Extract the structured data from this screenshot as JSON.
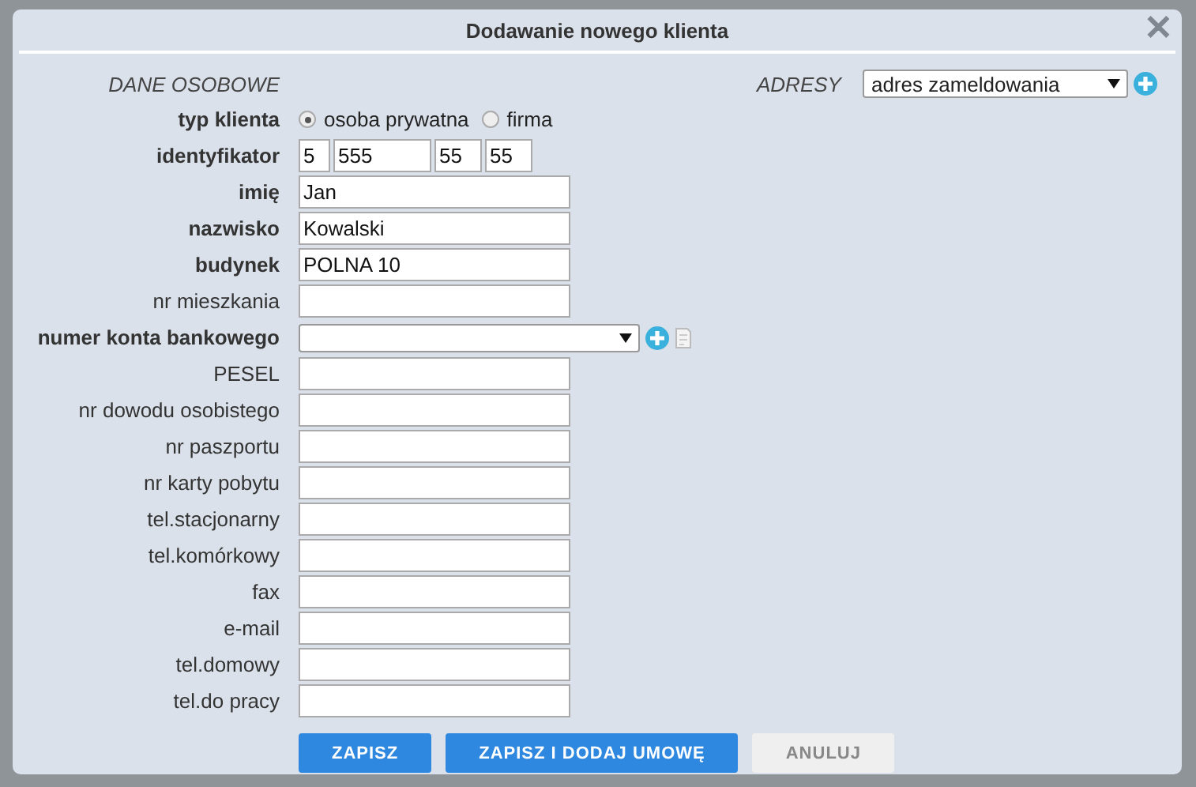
{
  "dialog": {
    "title": "Dodawanie nowego klienta",
    "close": "✕"
  },
  "section_personal": "DANE OSOBOWE",
  "section_address": {
    "label": "ADRESY",
    "value": "adres zameldowania"
  },
  "client_type": {
    "label": "typ klienta",
    "options": [
      {
        "label": "osoba prywatna",
        "selected": true
      },
      {
        "label": "firma",
        "selected": false
      }
    ]
  },
  "identifier": {
    "label": "identyfikator",
    "parts": [
      "5",
      "555",
      "55",
      "55"
    ]
  },
  "fields": [
    {
      "kind": "text",
      "label": "imię",
      "bold": true,
      "value": "Jan"
    },
    {
      "kind": "text",
      "label": "nazwisko",
      "bold": true,
      "value": "Kowalski"
    },
    {
      "kind": "text",
      "label": "budynek",
      "bold": true,
      "value": "POLNA 10"
    },
    {
      "kind": "text",
      "label": "nr mieszkania",
      "bold": false
    },
    {
      "kind": "select",
      "label": "numer konta bankowego",
      "bold": true
    },
    {
      "kind": "text",
      "label": "PESEL",
      "bold": false
    },
    {
      "kind": "text",
      "label": "nr dowodu osobistego",
      "bold": false
    },
    {
      "kind": "text",
      "label": "nr paszportu",
      "bold": false
    },
    {
      "kind": "text",
      "label": "nr karty pobytu",
      "bold": false
    },
    {
      "kind": "text",
      "label": "tel.stacjonarny",
      "bold": false
    },
    {
      "kind": "text",
      "label": "tel.komórkowy",
      "bold": false
    },
    {
      "kind": "text",
      "label": "fax",
      "bold": false
    },
    {
      "kind": "text",
      "label": "e-mail",
      "bold": false
    },
    {
      "kind": "text",
      "label": "tel.domowy",
      "bold": false
    },
    {
      "kind": "text",
      "label": "tel.do pracy",
      "bold": false
    }
  ],
  "buttons": [
    {
      "label": "ZAPISZ",
      "disabled": false
    },
    {
      "label": "ZAPISZ I DODAJ UMOWĘ",
      "disabled": false
    },
    {
      "label": "ANULUJ",
      "disabled": true
    }
  ]
}
